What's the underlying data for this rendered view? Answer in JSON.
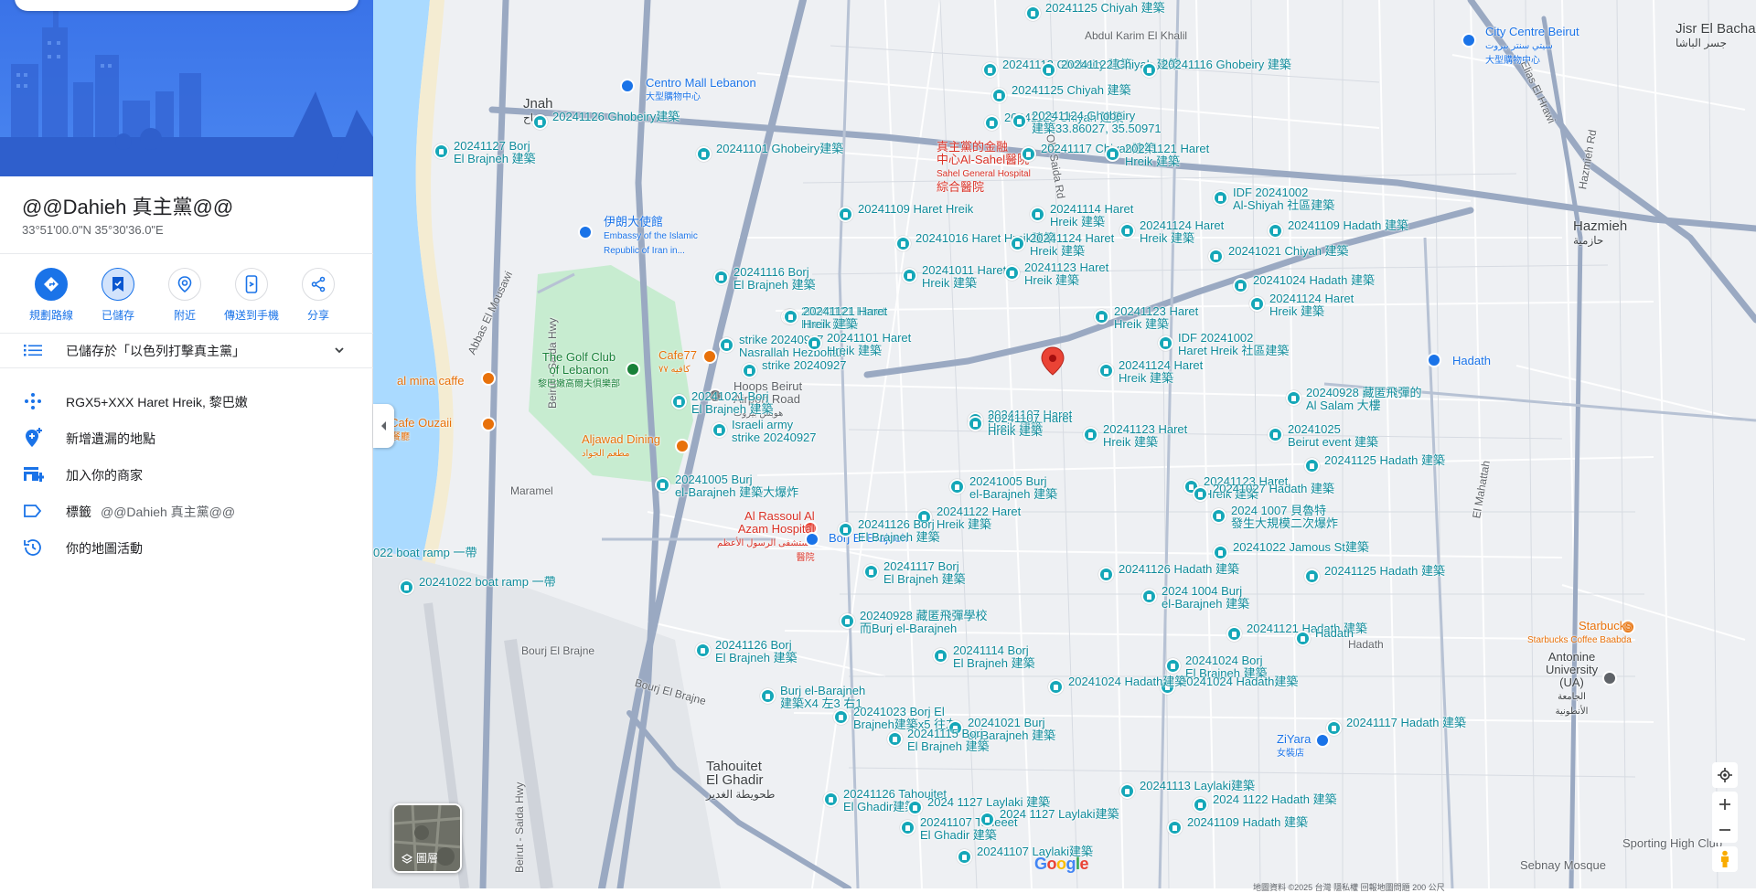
{
  "panel": {
    "place_name": "@@Dahieh 真主黨@@",
    "coords": "33°51'00.0\"N 35°30'36.0\"E",
    "actions": [
      {
        "label": "規劃路線",
        "icon": "directions-icon"
      },
      {
        "label": "已儲存",
        "icon": "saved-bookmark-icon"
      },
      {
        "label": "附近",
        "icon": "nearby-icon"
      },
      {
        "label": "傳送到手機",
        "icon": "send-to-phone-icon"
      },
      {
        "label": "分享",
        "icon": "share-icon"
      }
    ],
    "saved_in": "已儲存於「以色列打擊真主黨」",
    "plus_code": "RGX5+XXX Haret Hreik, 黎巴嫩",
    "add_missing_place": "新增遺漏的地點",
    "add_business": "加入你的商家",
    "label_title": "標籤",
    "label_value": "@@Dahieh 真主黨@@",
    "map_activity": "你的地圖活動"
  },
  "map": {
    "layers_label": "圖層",
    "google": "Google",
    "attribution": "地圖資料 ©2025   台灣   隱私權   回報地圖問題   200 公尺",
    "colors": {
      "pin": "#15a7b8",
      "label": "#0e8a9a",
      "selected": "#ea4335",
      "road_major": "#9aa9c2",
      "sea": "#aadaff",
      "park": "#c7ecd0"
    },
    "area_labels": [
      {
        "text": "Jnah\nجناح"
      },
      {
        "text": "Tahouitet\nEl Ghadir\nطحويطة الغدير"
      },
      {
        "text": "Hazmieh\nحازمية"
      },
      {
        "text": "Jisr El Bacha\nجسر الباشا"
      },
      {
        "text": "Hadath"
      },
      {
        "text": "Borj El Brajneh"
      }
    ],
    "street_labels": [
      "Abdul Karim El Khalil",
      "Old Saida Rd",
      "Elias El Hrawi",
      "Hazmieh Rd",
      "Abbas El Mousawi",
      "Bourj El Brajne",
      "Maramel",
      "Bourj El Brajne",
      "Beirut - Saida Hwy",
      "Beirut - Saida Hwy",
      "Ghobeiry",
      "Hadath",
      "El Mahattah",
      "Hadath",
      "Hadath",
      "Hadath"
    ],
    "pois": [
      {
        "text": "Centro Mall Lebanon\n大型購物中心",
        "color": "#1a73e8"
      },
      {
        "text": "伊朗大使館\nEmbassy of the Islamic\nRepublic of Iran in...",
        "color": "#1a73e8"
      },
      {
        "text": "The Golf Club\nof Lebanon\n黎巴嫩高爾夫俱樂部",
        "color": "#188038"
      },
      {
        "text": "Cafe77\nكافيه ٧٧",
        "color": "#e8710a"
      },
      {
        "text": "Hoops Beirut\nAirport Road\nهوبس بيروت",
        "color": "#5f6368"
      },
      {
        "text": "Aljawad Dining\nمطعم الجواد",
        "color": "#e8710a"
      },
      {
        "text": "al mina caffe",
        "color": "#e8710a"
      },
      {
        "text": "pa Cafe Ouzaii\n海鮮餐廳",
        "color": "#e8710a"
      },
      {
        "text": "Al Rassoul Al\nAzam Hospital\nمستشفى الرسول الأعظم\n醫院",
        "color": "#d93025"
      },
      {
        "text": "真主黨的金融\n中心Al-Sahel醫院\nSahel General Hospital\n綜合醫院",
        "color": "#d93025"
      },
      {
        "text": "City Centre Beirut\nسيتي سنتر بيروت\n大型購物中心",
        "color": "#1a73e8"
      },
      {
        "text": "Starbucks\nStarbucks Coffee Baabda",
        "color": "#e8710a"
      },
      {
        "text": "Antonine\nUniversity\n(UA)\nالجامعة\nالأنطونية",
        "color": "#5f6368"
      },
      {
        "text": "ZiYara\n女裝店",
        "color": "#1a73e8"
      },
      {
        "text": "Sporting High Club",
        "color": "#5f6368"
      },
      {
        "text": "Sebnay Mosque",
        "color": "#5f6368"
      },
      {
        "text": "Hadath",
        "color": "#1a73e8"
      }
    ],
    "pin_labels": [
      "20241125 Chiyah 建築",
      "20241113 Ghobeiry 建築",
      "20241122 Chiyah 建築",
      "20241116 Ghobeiry 建築",
      "20241125 Chiyah 建築",
      "20241125 Chiyah 建築",
      "20241124 Ghobeiry\n建築33.86027, 35.50971",
      "20241127 Borj\nEl Brajneh 建築",
      "20241126 Ghobeiry建築",
      "20241101 Ghobeiry建築",
      "20241117 Chiyah建築",
      "20241121 Haret\nHreik 建築",
      "IDF 20241002\nAl-Shiyah 社區建築",
      "20241109 Haret Hreik",
      "20241114 Haret\nHreik 建築",
      "20241016 Haret Hreik建築",
      "20241124 Haret\nHreik 建築",
      "20241124 Haret\nHreik 建築",
      "20241109 Hadath 建築",
      "20241021 Chiyah 建築",
      "20241116 Borj\nEl Brajneh 建築",
      "20241011 Haret\nHreik 建築",
      "20241123 Haret\nHreik 建築",
      "20241024 Hadath 建築",
      "20241121 Haret\nHreik 建築",
      "20241123 Haret\nHreik 建築",
      "20241124 Haret\nHreik 建築",
      "strike 20240927\nNasrallah Hezbollah",
      "20241101 Haret\nHreik 建築",
      "IDF 20241002\nHaret Hreik 社區建築",
      "strike 20240927",
      "20241124 Haret\nHreik 建築",
      "20241021 Borj\nEl Brajneh 建築",
      "20241121 Haret\nHreik 建築",
      "20240928 藏匿飛彈的\nAl Salam 大樓",
      "20241107 Haret\nHreik 建築",
      "Israeli army\nstrike 20240927",
      "20241107 Haret\nHreik 建築",
      "20241025\nBeirut event 建築",
      "20241123 Haret\nHreik 建築",
      "20241125 Hadath 建築",
      "20241005 Burj\nel-Barajneh 建築大爆炸",
      "20241005 Burj\nel-Barajneh 建築",
      "20241123 Haret\nHreik 建築",
      "20241027 Hadath 建築",
      "20241122 Haret\nHreik 建築",
      "2024 1007 貝魯特\n發生大規模二次爆炸",
      "20241126 Borj\nEl Brajneh 建築",
      "20241022 Jamous St建築",
      "20241117 Borj\nEl Brajneh 建築",
      "20241126 Hadath 建築",
      "20241125 Hadath 建築",
      "2024 1004 Burj\nel-Barajneh 建築",
      "20240928 藏匿飛彈學校\n而Burj el-Barajneh",
      "20241121 Hadath 建築",
      "20241126 Borj\nEl Brajneh 建築",
      "20241114 Borj\nEl Brajneh 建築",
      "20241024 Borj\nEl Brajneh 建築",
      "Burj el-Barajneh\n建築X4 左3 右1",
      "20241024 Hadath建築",
      "20241024 Hadath建築",
      "20241023 Borj El\nBrajneh建築x5 往左",
      "20241021 Burj\nel-Barajneh 建築",
      "20241117 Hadath 建築",
      "20241115 Borj\nEl Brajneh 建築",
      "20241113 Laylaki建築",
      "20241126 Tahouitet\nEl Ghadir建築",
      "2024 1127 Laylaki 建築",
      "2024 1122 Hadath 建築",
      "20241107 Taheeet\nEl Ghadir 建築",
      "2024 1127 Laylaki建築",
      "20241109 Hadath 建築",
      "20241107 Laylaki建築",
      "20241022 boat ramp 一帶",
      "022 boat ramp 一帶",
      "Hadath"
    ]
  }
}
